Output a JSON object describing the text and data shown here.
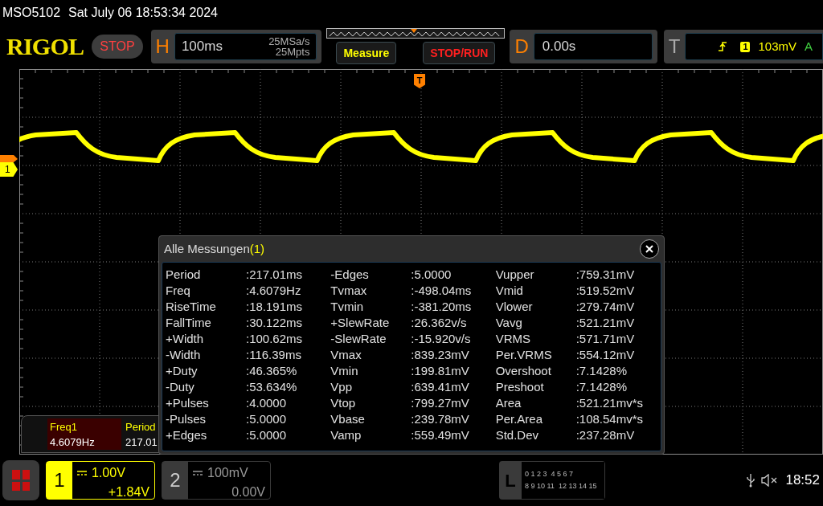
{
  "top_status": {
    "model": "MSO5102",
    "datetime": "Sat July 06 18:53:34 2024"
  },
  "toolbar": {
    "logo": "RIGOL",
    "run_state": "STOP",
    "horizontal": {
      "label": "H",
      "timebase": "100ms",
      "sample_rate": "25MSa/s",
      "memory_depth": "25Mpts"
    },
    "buttons": [
      {
        "label": "Measure",
        "kind": "measure"
      },
      {
        "label": "STOP/RUN",
        "kind": "run"
      }
    ],
    "delay": {
      "label": "D",
      "value": "0.00s"
    },
    "trigger": {
      "label": "T",
      "source": "1",
      "level": "103mV",
      "mode": "A"
    }
  },
  "display": {
    "trigger_marker": "T",
    "channel_marker": "1"
  },
  "measurement_bar": [
    {
      "name": "Freq1",
      "value": "4.6079Hz",
      "selected": true
    },
    {
      "name": "Period",
      "value": "217.01",
      "selected": false
    }
  ],
  "dialog": {
    "title": "Alle Messungen",
    "channel": "(1)",
    "columns": [
      [
        {
          "name": "Period",
          "value": ":217.01ms"
        },
        {
          "name": "Freq",
          "value": ":4.6079Hz"
        },
        {
          "name": "RiseTime",
          "value": ":18.191ms"
        },
        {
          "name": "FallTime",
          "value": ":30.122ms"
        },
        {
          "name": "+Width",
          "value": ":100.62ms"
        },
        {
          "name": "-Width",
          "value": ":116.39ms"
        },
        {
          "name": "+Duty",
          "value": ":46.365%"
        },
        {
          "name": "-Duty",
          "value": ":53.634%"
        },
        {
          "name": "+Pulses",
          "value": ":4.0000"
        },
        {
          "name": "-Pulses",
          "value": ":5.0000"
        },
        {
          "name": "+Edges",
          "value": ":5.0000"
        }
      ],
      [
        {
          "name": "-Edges",
          "value": ":5.0000"
        },
        {
          "name": "Tvmax",
          "value": ":-498.04ms"
        },
        {
          "name": "Tvmin",
          "value": ":-381.20ms"
        },
        {
          "name": "+SlewRate",
          "value": ":26.362v/s"
        },
        {
          "name": "-SlewRate",
          "value": ":-15.920v/s"
        },
        {
          "name": "Vmax",
          "value": ":839.23mV"
        },
        {
          "name": "Vmin",
          "value": ":199.81mV"
        },
        {
          "name": "Vpp",
          "value": ":639.41mV"
        },
        {
          "name": "Vtop",
          "value": ":799.27mV"
        },
        {
          "name": "Vbase",
          "value": ":239.78mV"
        },
        {
          "name": "Vamp",
          "value": ":559.49mV"
        }
      ],
      [
        {
          "name": "Vupper",
          "value": ":759.31mV"
        },
        {
          "name": "Vmid",
          "value": ":519.52mV"
        },
        {
          "name": "Vlower",
          "value": ":279.74mV"
        },
        {
          "name": "Vavg",
          "value": ":521.21mV"
        },
        {
          "name": "VRMS",
          "value": ":571.71mV"
        },
        {
          "name": "Per.VRMS",
          "value": ":554.12mV"
        },
        {
          "name": "Overshoot",
          "value": ":7.1428%"
        },
        {
          "name": "Preshoot",
          "value": ":7.1428%"
        },
        {
          "name": "Area",
          "value": ":521.21mv*s"
        },
        {
          "name": "Per.Area",
          "value": ":108.54mv*s"
        },
        {
          "name": "Std.Dev",
          "value": ":237.28mV"
        }
      ]
    ]
  },
  "bottom_bar": {
    "channels": [
      {
        "number": "1",
        "scale": "1.00V",
        "offset": "+1.84V",
        "selected": true
      },
      {
        "number": "2",
        "scale": "100mV",
        "offset": "0.00V",
        "selected": false
      }
    ],
    "logic": {
      "label": "L",
      "rows": [
        [
          "0 1 2 3",
          "4 5 6 7"
        ],
        [
          "8 9 10 11",
          "12 13 14 15"
        ]
      ]
    },
    "clock": "18:52"
  }
}
